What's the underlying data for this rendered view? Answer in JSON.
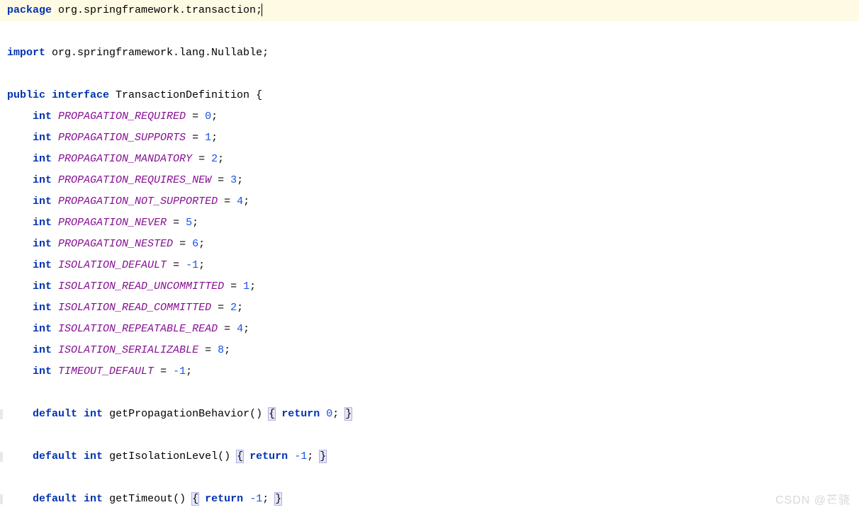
{
  "code": {
    "kw_package": "package",
    "pkg_name": " org.springframework.transaction;",
    "kw_import": "import",
    "import_name": " org.springframework.lang.Nullable;",
    "kw_public": "public",
    "kw_interface": " interface",
    "class_name": " TransactionDefinition ",
    "brace_open": "{",
    "brace_close": "}",
    "indent1": "    ",
    "kw_int": "int",
    "field_propagation_required": " PROPAGATION_REQUIRED ",
    "eq": "= ",
    "val_0": "0",
    "semi": ";",
    "field_propagation_supports": " PROPAGATION_SUPPORTS ",
    "val_1": "1",
    "field_propagation_mandatory": " PROPAGATION_MANDATORY ",
    "val_2": "2",
    "field_propagation_requires_new": " PROPAGATION_REQUIRES_NEW ",
    "val_3": "3",
    "field_propagation_not_supported": " PROPAGATION_NOT_SUPPORTED ",
    "val_4": "4",
    "field_propagation_never": " PROPAGATION_NEVER ",
    "val_5": "5",
    "field_propagation_nested": " PROPAGATION_NESTED ",
    "val_6": "6",
    "field_isolation_default": " ISOLATION_DEFAULT ",
    "val_m1": "-1",
    "field_isolation_read_uncommitted": " ISOLATION_READ_UNCOMMITTED ",
    "field_isolation_read_committed": " ISOLATION_READ_COMMITTED ",
    "field_isolation_repeatable_read": " ISOLATION_REPEATABLE_READ ",
    "field_isolation_serializable": " ISOLATION_SERIALIZABLE ",
    "val_8": "8",
    "field_timeout_default": " TIMEOUT_DEFAULT ",
    "kw_default": "default",
    "kw_return": "return",
    "sp": " ",
    "method_getPropagationBehavior": "getPropagationBehavior",
    "parens": "()",
    "method_getIsolationLevel": "getIsolationLevel",
    "method_getTimeout": "getTimeout"
  },
  "watermark": "CSDN @芒骁"
}
